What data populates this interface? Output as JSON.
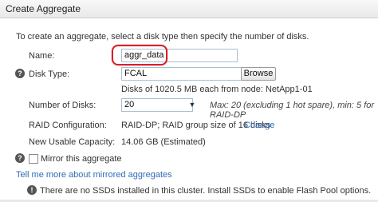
{
  "window": {
    "title": "Create Aggregate"
  },
  "intro_text": "To create an aggregate, select a disk type then specify the number of disks.",
  "form": {
    "name_label": "Name:",
    "name_value": "aggr_data",
    "disk_type_label": "Disk Type:",
    "disk_type_value": "FCAL",
    "browse_label": "Browse",
    "disk_info": "Disks of 1020.5 MB each from node: NetApp1-01",
    "num_disks_label": "Number of Disks:",
    "num_disks_value": "20",
    "num_disks_hint": "Max: 20 (excluding 1 hot spare), min: 5 for RAID-DP",
    "raid_label": "RAID Configuration:",
    "raid_value": "RAID-DP; RAID group size of 16 disks",
    "raid_change": "Change",
    "capacity_label": "New Usable Capacity:",
    "capacity_value": "14.06 GB (Estimated)",
    "mirror_label": "Mirror this aggregate",
    "mirror_checked": false,
    "mirror_link": "Tell me more about mirrored aggregates",
    "ssd_notice": "There are no SSDs installed in this cluster. Install SSDs to enable Flash Pool options."
  },
  "icons": {
    "help": "question-mark-icon",
    "info": "info-icon",
    "dropdown": "chevron-down-icon"
  },
  "colors": {
    "highlight": "#d92027",
    "link": "#2f6cb5"
  }
}
